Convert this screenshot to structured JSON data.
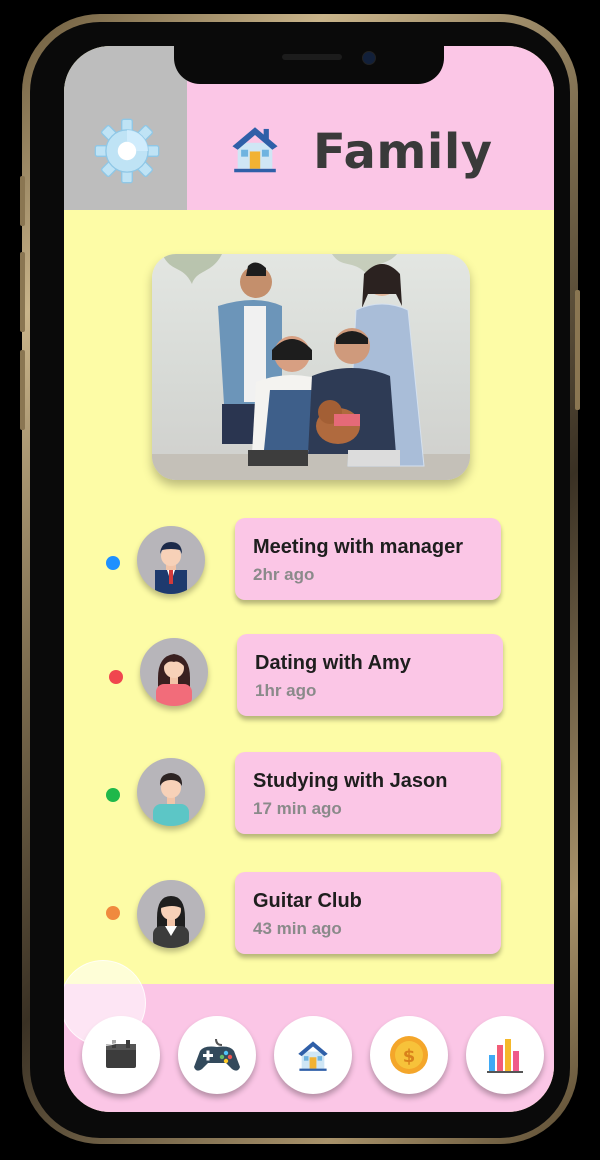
{
  "header": {
    "title": "Family"
  },
  "activities": [
    {
      "title": "Meeting with manager",
      "time": "2hr ago",
      "dot_color": "#1e90ff"
    },
    {
      "title": "Dating with Amy",
      "time": "1hr ago",
      "dot_color": "#f0464e"
    },
    {
      "title": "Studying with Jason",
      "time": "17 min ago",
      "dot_color": "#1fb84a"
    },
    {
      "title": "Guitar Club",
      "time": "43 min ago",
      "dot_color": "#f08a3e"
    }
  ],
  "bottom_nav": [
    {
      "icon": "calendar-icon"
    },
    {
      "icon": "gamepad-icon"
    },
    {
      "icon": "house-icon"
    },
    {
      "icon": "coin-icon"
    },
    {
      "icon": "bar-chart-icon"
    }
  ],
  "colors": {
    "background": "#fdfca6",
    "header_pink": "#fbc6e6",
    "settings_gray": "#bdbdbd"
  }
}
